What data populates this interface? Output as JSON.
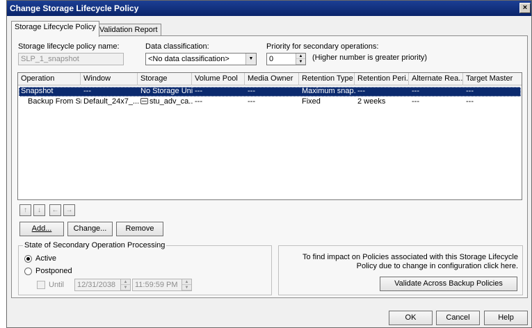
{
  "window": {
    "title": "Change Storage Lifecycle Policy",
    "close_label": "×"
  },
  "tabs": [
    {
      "label": "Storage Lifecycle Policy"
    },
    {
      "label": "Validation Report"
    }
  ],
  "form": {
    "policy_name_label": "Storage lifecycle policy name:",
    "policy_name_value": "SLP_1_snapshot",
    "data_classification_label": "Data classification:",
    "data_classification_value": "<No data classification>",
    "priority_label": "Priority for secondary operations:",
    "priority_value": "0",
    "priority_hint": "(Higher number is greater priority)"
  },
  "grid": {
    "columns": [
      "Operation",
      "Window",
      "Storage",
      "Volume Pool",
      "Media Owner",
      "Retention Type",
      "Retention Peri...",
      "Alternate Rea...",
      "Target Master"
    ],
    "rows": [
      {
        "cells": [
          "Snapshot",
          "---",
          "No Storage Unit",
          "---",
          "---",
          "Maximum snap...",
          "---",
          "---",
          "---"
        ]
      },
      {
        "cells": [
          "Backup From Sn...",
          "Default_24x7_...",
          "stu_adv_ca...",
          "---",
          "---",
          "Fixed",
          "2 weeks",
          "---",
          "---"
        ]
      }
    ]
  },
  "buttons": {
    "move_up": "↑",
    "move_down": "↓",
    "move_left": "←",
    "move_right": "→",
    "add": "Add...",
    "change": "Change...",
    "remove": "Remove",
    "validate": "Validate Across Backup Policies",
    "ok": "OK",
    "cancel": "Cancel",
    "help": "Help"
  },
  "state_group": {
    "title": "State of Secondary Operation Processing",
    "active_label": "Active",
    "postponed_label": "Postponed",
    "until_label": "Until",
    "date_value": "12/31/2038",
    "time_value": "11:59:59 PM"
  },
  "impact": {
    "text": "To find impact on Policies associated with this Storage Lifecycle Policy due to change in configuration click here."
  }
}
